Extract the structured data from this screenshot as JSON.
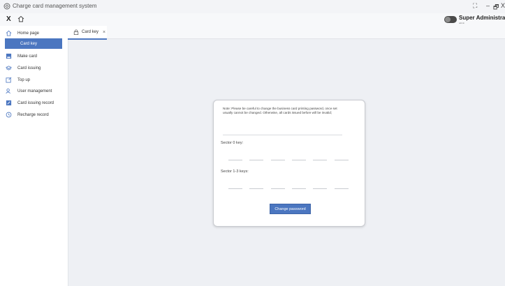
{
  "window": {
    "title": "Charge card management system",
    "controls": [
      "[ ]",
      "—",
      "□",
      "X"
    ]
  },
  "header": {
    "close_label": "X",
    "user_name": "Super Administrator",
    "user_sub": "admin"
  },
  "sidebar": {
    "items": [
      {
        "label": "Home page",
        "icon": "home-icon"
      },
      {
        "label": "Card key",
        "icon": "",
        "active": true
      },
      {
        "label": "Make card",
        "icon": "card-printer-icon"
      },
      {
        "label": "Card issuing",
        "icon": "layers-icon"
      },
      {
        "label": "Top up",
        "icon": "edit-icon"
      },
      {
        "label": "User management",
        "icon": "users-icon"
      },
      {
        "label": "Card issuing record",
        "icon": "record-icon"
      },
      {
        "label": "Recharge record",
        "icon": "history-icon"
      }
    ]
  },
  "tabs": [
    {
      "label": "Card key",
      "icon": "lock-icon",
      "close": "×"
    }
  ],
  "form": {
    "note": "Note: Please be careful to change the business card printing password, once set usually cannot be changed. Otherwise, all cards issued before will be invalid;",
    "sector0_label": "Sector 0 key:",
    "sector13_label": "Sector 1-3 keys:",
    "submit_label": "Change password"
  },
  "colors": {
    "accent": "#4b76c0",
    "background": "#eef0f4"
  }
}
